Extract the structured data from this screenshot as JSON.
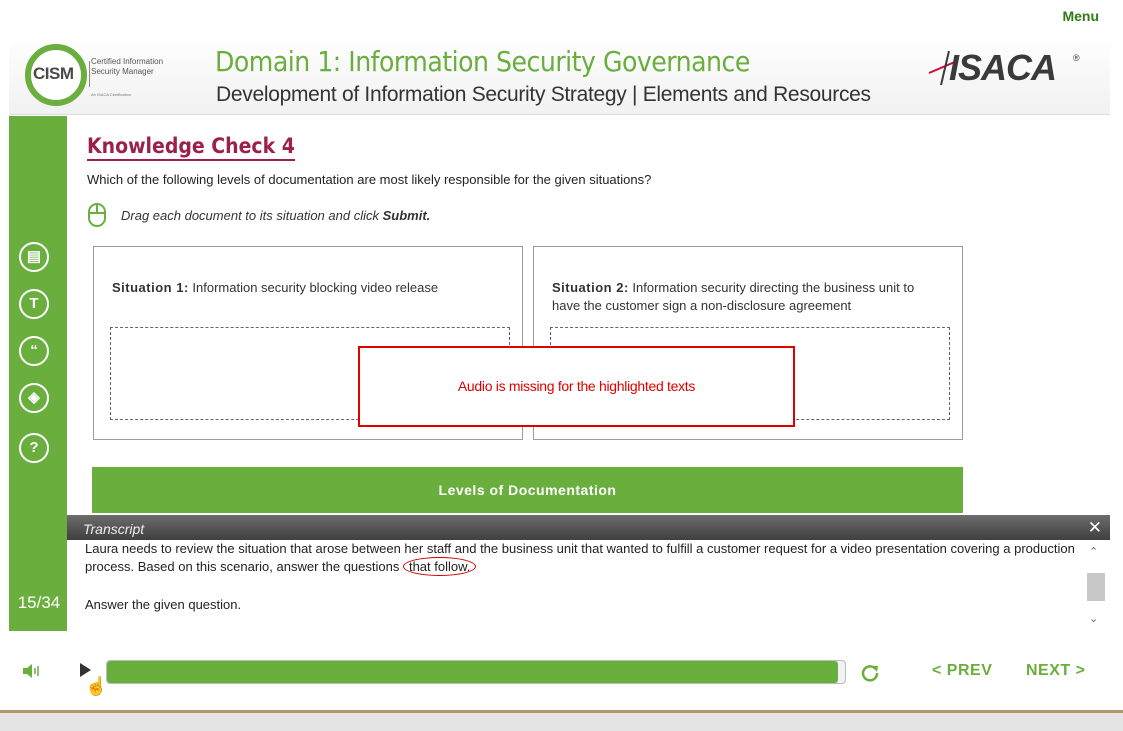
{
  "menu": {
    "label": "Menu"
  },
  "header": {
    "cism_logo": {
      "word": "CISM",
      "tagline_1": "Certified Information",
      "tagline_2": "Security Manager",
      "fine_print": "An ISACA Certification"
    },
    "title": "Domain 1: Information Security Governance",
    "subtitle": "Development of Information Security Strategy | Elements and Resources",
    "isaca_logo": {
      "word": "ISACA",
      "reg": "®"
    }
  },
  "sidebar": {
    "icons": [
      "glossary-icon",
      "transcript-toggle-icon",
      "quote-icon",
      "resources-icon",
      "help-icon"
    ],
    "icon_glyphs": [
      "▤",
      "T",
      "“",
      "◈",
      "?"
    ],
    "page_counter": "15/34"
  },
  "knowledge_check": {
    "title": "Knowledge Check 4",
    "question": "Which of the following levels of documentation are most likely responsible for the given situations?",
    "instruction_prefix": "Drag each document to its situation and click ",
    "instruction_action": "Submit.",
    "situations": [
      {
        "label": "Situation 1:",
        "text": "Information security blocking video release"
      },
      {
        "label": "Situation 2:",
        "text": "Information security directing the business unit to have the customer sign a non-disclosure agreement"
      }
    ],
    "levels_bar_label": "Levels of Documentation"
  },
  "annotation": {
    "audio_note": "Audio is missing for the highlighted texts"
  },
  "transcript": {
    "title": "Transcript",
    "close": "✕",
    "para1_main": "Laura needs to review the situation that arose between her staff and the business unit that wanted to fulfill a customer request for a video presentation covering a production process. Based on this scenario, answer the questions ",
    "para1_highlight": "that follow.",
    "para2": "Answer the given question.",
    "scroll_up": "⌃",
    "scroll_down": "⌄"
  },
  "controls": {
    "progress": 0.99,
    "prev": "< PREV",
    "next": "NEXT >"
  },
  "colors": {
    "brand_green": "#6aae3e",
    "title_maroon": "#9c1f4c",
    "alert_red": "#e00000"
  }
}
